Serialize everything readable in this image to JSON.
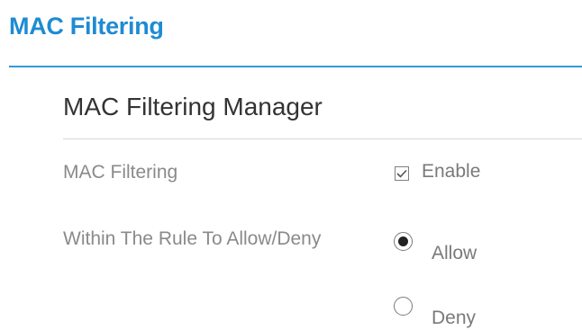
{
  "header": {
    "title": "MAC Filtering"
  },
  "section": {
    "title": "MAC Filtering Manager"
  },
  "fields": {
    "mac_filtering": {
      "label": "MAC Filtering",
      "option_label": "Enable",
      "checked": true
    },
    "rule": {
      "label": "Within The Rule To Allow/Deny",
      "options": [
        {
          "label": "Allow",
          "selected": true
        },
        {
          "label": "Deny",
          "selected": false
        }
      ]
    }
  },
  "colors": {
    "accent": "#1e8bd3",
    "text_muted": "#8a8a8a"
  }
}
